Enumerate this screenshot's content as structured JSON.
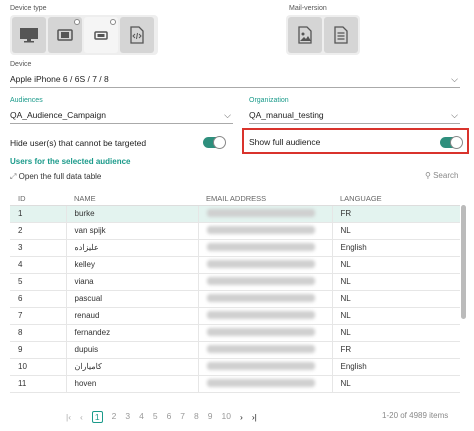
{
  "device_type_label": "Device type",
  "mail_version_label": "Mail-version",
  "device_buttons": [
    {
      "icon": "desktop-icon",
      "active": false
    },
    {
      "icon": "tablet-icon",
      "active": false
    },
    {
      "icon": "phone-landscape-icon",
      "active": true
    },
    {
      "icon": "code-icon",
      "active": false
    }
  ],
  "mail_buttons": [
    {
      "icon": "image-icon"
    },
    {
      "icon": "document-icon"
    }
  ],
  "device": {
    "label": "Device",
    "value": "Apple iPhone 6 / 6S / 7 / 8"
  },
  "audiences": {
    "label": "Audiences",
    "value": "QA_Audience_Campaign"
  },
  "organization": {
    "label": "Organization",
    "value": "QA_manual_testing"
  },
  "hide_users_label": "Hide user(s) that cannot be targeted",
  "show_full_label": "Show full audience",
  "section_title": "Users for the selected audience",
  "open_table_link": "Open the full data table",
  "search_placeholder": "Search",
  "columns": [
    "ID",
    "NAME",
    "EMAIL ADDRESS",
    "LANGUAGE"
  ],
  "rows": [
    {
      "id": "1",
      "name": "burke",
      "lang": "FR"
    },
    {
      "id": "2",
      "name": "van spijk",
      "lang": "NL"
    },
    {
      "id": "3",
      "name": "عليزاده",
      "lang": "English"
    },
    {
      "id": "4",
      "name": "kelley",
      "lang": "NL"
    },
    {
      "id": "5",
      "name": "viana",
      "lang": "NL"
    },
    {
      "id": "6",
      "name": "pascual",
      "lang": "NL"
    },
    {
      "id": "7",
      "name": "renaud",
      "lang": "NL"
    },
    {
      "id": "8",
      "name": "fernandez",
      "lang": "NL"
    },
    {
      "id": "9",
      "name": "dupuis",
      "lang": "FR"
    },
    {
      "id": "10",
      "name": "كامياران",
      "lang": "English"
    },
    {
      "id": "11",
      "name": "hoven",
      "lang": "NL"
    }
  ],
  "pagination": {
    "pages": [
      "1",
      "2",
      "3",
      "4",
      "5",
      "6",
      "7",
      "8",
      "9",
      "10"
    ],
    "current": "1",
    "range_text": "1-20 of 4989 items"
  },
  "accent_color": "#1a9a8a",
  "highlight_color": "#d9332c"
}
